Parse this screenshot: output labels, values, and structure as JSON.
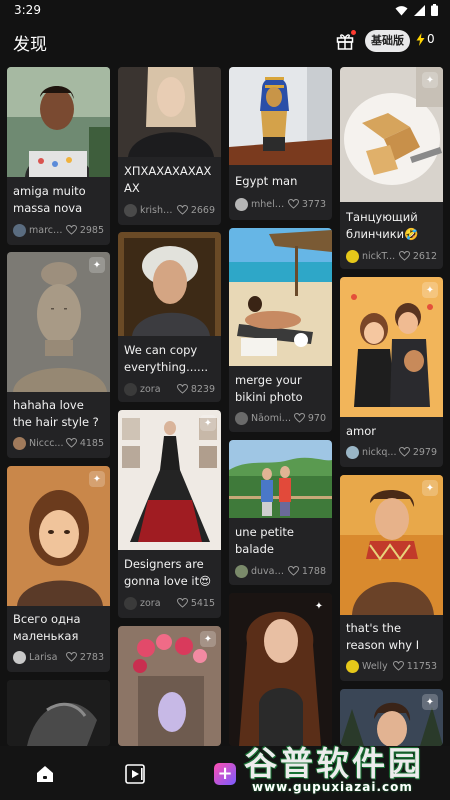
{
  "status_bar": {
    "time": "3:29"
  },
  "header": {
    "title": "发现",
    "plan_badge": "基础版",
    "credits": "0"
  },
  "colors": {
    "accent": "#ffd400",
    "create_gradient_start": "#ff4fb1",
    "create_gradient_end": "#7a5cff",
    "background": "#121212",
    "card": "#232325"
  },
  "feed": {
    "c1": {
      "caption": "amiga muito massa nova at...",
      "author": "marce...",
      "likes": "2985"
    },
    "c2": {
      "caption": "hahaha love the hair style ?",
      "author": "Niccc...",
      "likes": "4185"
    },
    "c3": {
      "caption": "Всего одна маленькая по...",
      "author": "Larisa",
      "likes": "2783"
    },
    "c4": {},
    "c5": {
      "caption": "ХПХАХАХАХАХАХ",
      "author": "krisha...",
      "likes": "2669"
    },
    "c6": {
      "caption": "We can copy everything......👀",
      "author": "zora",
      "likes": "8239"
    },
    "c7": {
      "caption": "Designers are gonna love it😍",
      "author": "zora",
      "likes": "5415"
    },
    "c8": {},
    "c9": {
      "caption": "Egypt man",
      "author": "mhela...",
      "likes": "3773"
    },
    "c10": {
      "caption": "merge your bikini photo wit...",
      "author": "Nāomi J...",
      "likes": "970"
    },
    "c11": {
      "caption": "une petite balade",
      "author": "duvalf...",
      "likes": "1788"
    },
    "c12": {},
    "c13": {
      "caption": "Танцующий блинчики🤣",
      "author": "nickT...",
      "likes": "2612"
    },
    "c14": {
      "caption": "amor",
      "author": "nickq...",
      "likes": "2979"
    },
    "c15": {
      "caption": "that's the reason why I work out ...",
      "author": "Welly",
      "likes": "11753"
    },
    "c16": {}
  },
  "watermark": {
    "line1": "谷普软件园",
    "line2": "www.gupuxiazai.com"
  },
  "icons": {
    "status": [
      "wifi-icon",
      "signal-icon",
      "battery-icon"
    ],
    "header": [
      "gift-icon",
      "lightning-icon"
    ],
    "card": [
      "heart-icon",
      "sparkle-icon"
    ],
    "nav": [
      "home-icon",
      "video-icon",
      "create-icon"
    ]
  }
}
